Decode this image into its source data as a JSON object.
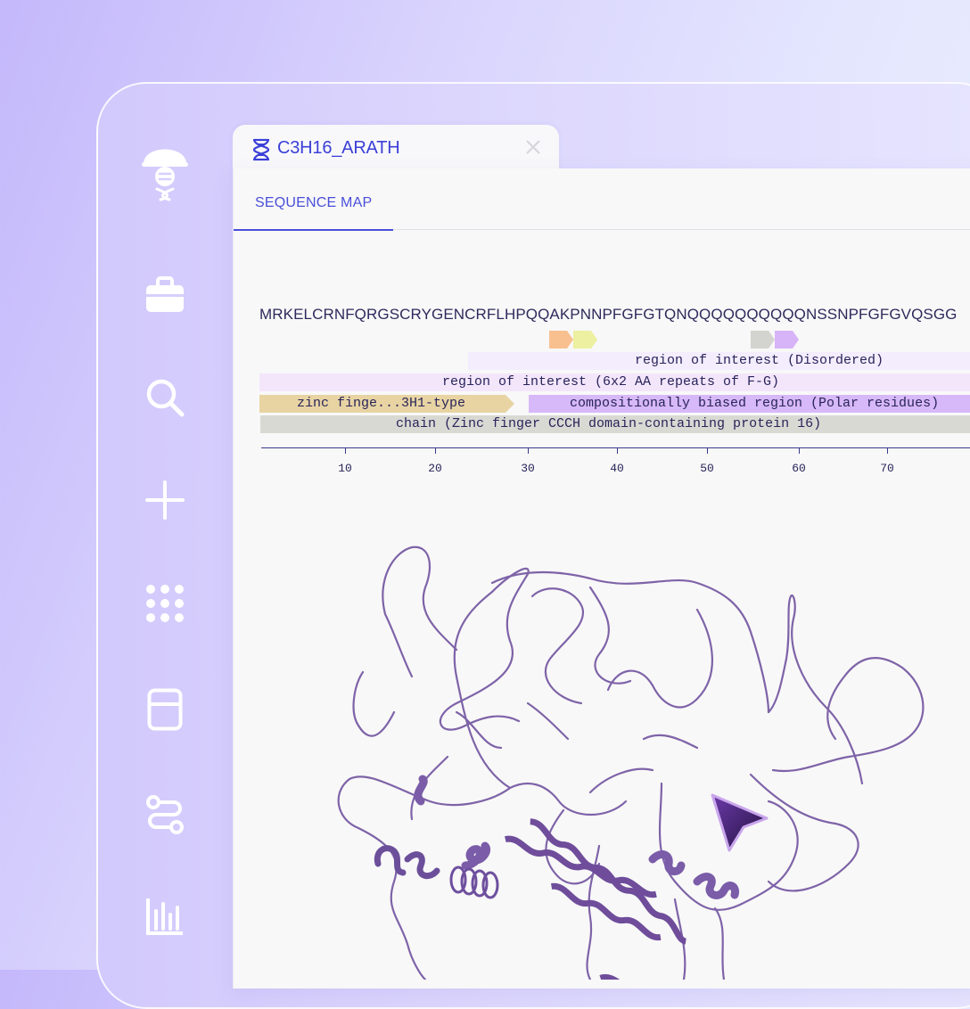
{
  "sidebar": {
    "items": [
      {
        "icon": "logo-scientist-icon"
      },
      {
        "icon": "briefcase-icon"
      },
      {
        "icon": "search-icon"
      },
      {
        "icon": "plus-icon"
      },
      {
        "icon": "grid-icon"
      },
      {
        "icon": "panel-icon"
      },
      {
        "icon": "workflow-icon"
      },
      {
        "icon": "bar-chart-icon"
      }
    ]
  },
  "tab": {
    "title": "C3H16_ARATH",
    "icon": "dna-icon",
    "close_icon": "close-icon"
  },
  "subtabs": {
    "active": "SEQUENCE MAP"
  },
  "sequence": "MRKELCRNFQRGSCRYGENCRFLHPQQAKPNNPFGFGTQNQQQQQQQQQQNSSNPFGFGVQSGG",
  "tracks": {
    "disordered": "region of interest (Disordered)",
    "repeats": "region of interest (6x2 AA repeats of F-G)",
    "zinc": "zinc finge...3H1-type",
    "polar": "compositionally biased region (Polar residues)",
    "chain": "chain (Zinc finger CCCH domain-containing protein 16)"
  },
  "axis": {
    "ticks": [
      "10",
      "20",
      "30",
      "40",
      "50",
      "60",
      "70"
    ]
  },
  "colors": {
    "accent": "#4a4fd9",
    "disordered": "#f3edfd",
    "repeats": "#f3e6fb",
    "zinc": "#e8d4a3",
    "polar": "#d7b8f8",
    "chain": "#d9d9d3",
    "marker_orange": "#f9c08f",
    "marker_yellow": "#ecf0a0",
    "marker_gray": "#d3d3cf",
    "marker_violet": "#d7b3f8",
    "protein": "#7e63a8"
  }
}
